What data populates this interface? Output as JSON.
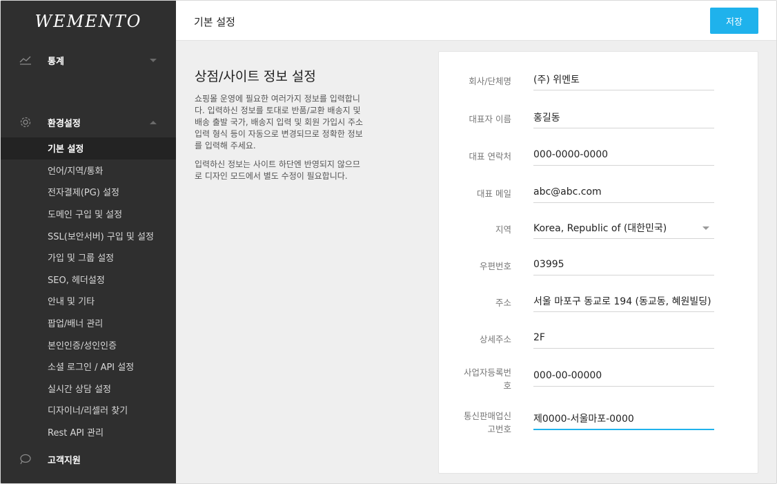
{
  "brand": {
    "logo": "WEMENTO"
  },
  "sidebar": {
    "groups": [
      {
        "label": "통계",
        "icon": "chart-line-icon"
      },
      {
        "label": "환경설정",
        "icon": "gear-icon"
      },
      {
        "label": "고객지원",
        "icon": "chat-bubble-icon"
      }
    ],
    "items": [
      {
        "label": "기본 설정",
        "active": true
      },
      {
        "label": "언어/지역/통화"
      },
      {
        "label": "전자결제(PG) 설정"
      },
      {
        "label": "도메인 구입 및 설정"
      },
      {
        "label": "SSL(보안서버) 구입 및 설정"
      },
      {
        "label": "가입 및 그룹 설정"
      },
      {
        "label": "SEO, 헤더설정"
      },
      {
        "label": "안내 및 기타"
      },
      {
        "label": "팝업/배너 관리"
      },
      {
        "label": "본인인증/성인인증"
      },
      {
        "label": "소셜 로그인 / API 설정"
      },
      {
        "label": "실시간 상담 설정"
      },
      {
        "label": "디자이너/리셀러 찾기"
      },
      {
        "label": "Rest API 관리"
      }
    ]
  },
  "header": {
    "title": "기본 설정",
    "save_label": "저장"
  },
  "intro": {
    "title": "상점/사이트 정보 설정",
    "para1": "쇼핑몰 운영에 필요한 여러가지 정보를 입력합니다. 입력하신 정보를 토대로 반품/교환 배송지 및 배송 출발 국가, 배송지 입력 및 회원 가입시 주소 입력 형식 등이 자동으로 변경되므로 정확한 정보를 입력해 주세요.",
    "para2": "입력하신 정보는 사이트 하단엔 반영되지 않으므로 디자인 모드에서 별도 수정이 필요합니다."
  },
  "form": {
    "fields": [
      {
        "label": "회사/단체명",
        "value": "(주) 위멘토"
      },
      {
        "label": "대표자 이름",
        "value": "홍길동"
      },
      {
        "label": "대표 연락처",
        "value": "000-0000-0000"
      },
      {
        "label": "대표 메일",
        "value": "abc@abc.com"
      },
      {
        "label": "지역",
        "value": "Korea, Republic of (대한민국)"
      },
      {
        "label": "우편번호",
        "value": "03995"
      },
      {
        "label": "주소",
        "value": "서울 마포구 동교로 194 (동교동, 혜원빌딩)"
      },
      {
        "label": "상세주소",
        "value": "2F"
      },
      {
        "label": "사업자등록번호",
        "value": "000-00-00000"
      },
      {
        "label": "통신판매업신고번호",
        "value": "제0000-서울마포-0000"
      }
    ]
  },
  "colors": {
    "accent": "#1fb2ec",
    "sidebar_bg": "#2f2f2f",
    "sidebar_active": "#232323"
  }
}
